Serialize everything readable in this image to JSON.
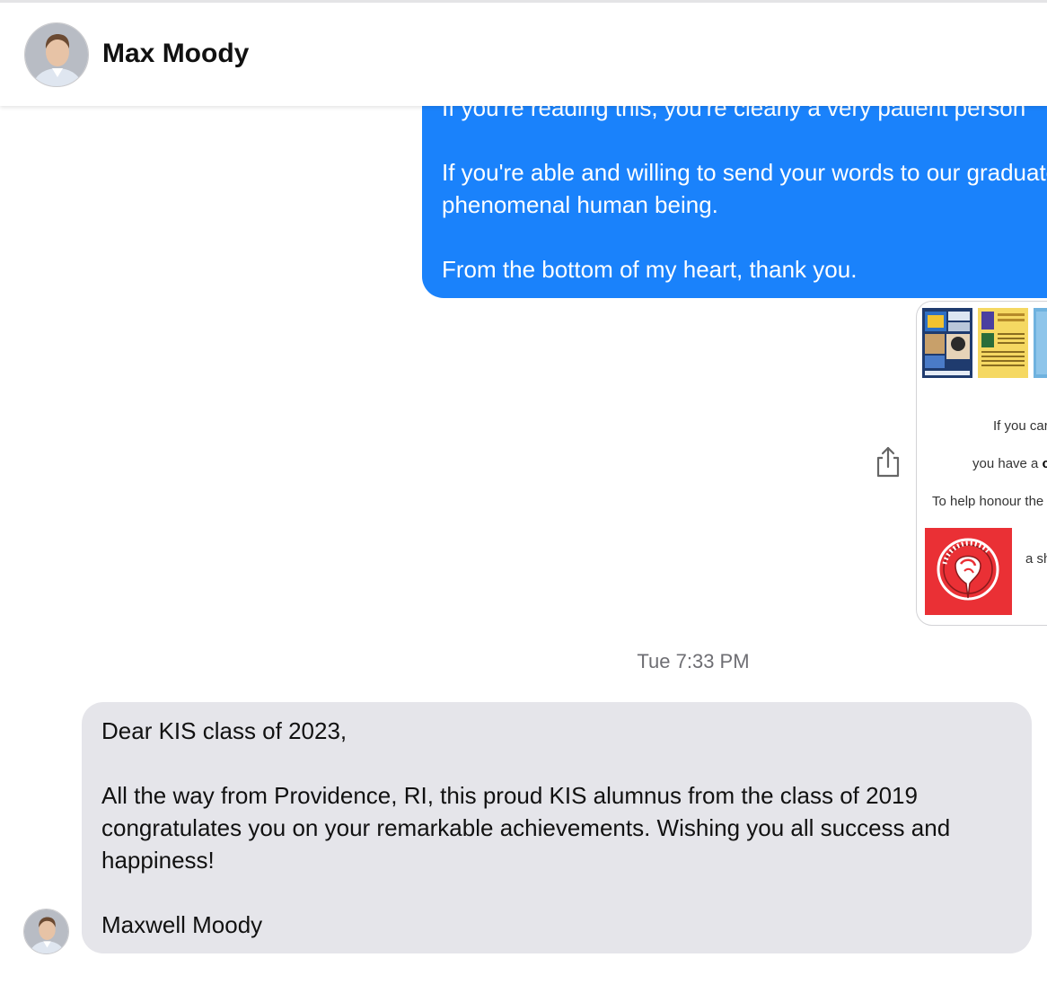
{
  "contact": {
    "name": "Max Moody"
  },
  "outgoing_message": {
    "lines": [
      "If you're reading this, you're clearly a very patient person",
      "If you're able and willing to send your words to our graduates",
      "phenomenal human being.",
      "From the bottom of my heart, thank you."
    ],
    "color": "#1a82fb"
  },
  "attachment_preview": {
    "lines": [
      "If you car",
      "you have a ",
      "To help honour the",
      "a sh"
    ],
    "bold_fragment": "c",
    "logo_text": "Kyiv International School",
    "logo_color": "#ea3035"
  },
  "timestamp": "Tue 7:33 PM",
  "incoming_message": {
    "greeting": "Dear KIS class of 2023,",
    "body": "All the way from Providence, RI, this proud KIS alumnus from the class of 2019 congratulates you on your remarkable achievements. Wishing you all success and happiness!",
    "signature": "Maxwell Moody",
    "color": "#e5e5ea"
  },
  "icons": {
    "share": "share-icon",
    "avatar": "avatar"
  }
}
